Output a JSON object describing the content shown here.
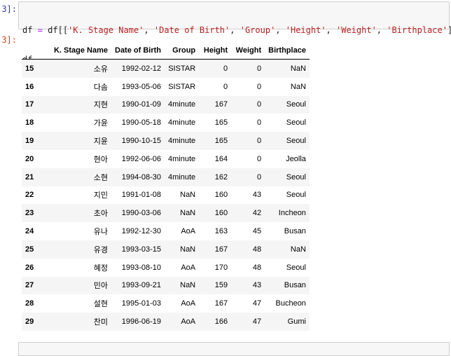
{
  "input_prompt": "3]:",
  "output_prompt": "3]:",
  "code": {
    "line1": [
      {
        "t": "name",
        "v": "df "
      },
      {
        "t": "op",
        "v": "="
      },
      {
        "t": "name",
        "v": " df"
      },
      {
        "t": "punc",
        "v": "[["
      },
      {
        "t": "str",
        "v": "'K. Stage Name'"
      },
      {
        "t": "punc",
        "v": ", "
      },
      {
        "t": "str",
        "v": "'Date of Birth'"
      },
      {
        "t": "punc",
        "v": ", "
      },
      {
        "t": "str",
        "v": "'Group'"
      },
      {
        "t": "punc",
        "v": ", "
      },
      {
        "t": "str",
        "v": "'Height'"
      },
      {
        "t": "punc",
        "v": ", "
      },
      {
        "t": "str",
        "v": "'Weight'"
      },
      {
        "t": "punc",
        "v": ", "
      },
      {
        "t": "str",
        "v": "'Birthplace'"
      },
      {
        "t": "punc",
        "v": "]]"
      }
    ],
    "line2": "df"
  },
  "table": {
    "columns": [
      "",
      "K. Stage Name",
      "Date of Birth",
      "Group",
      "Height",
      "Weight",
      "Birthplace"
    ],
    "rows": [
      [
        "15",
        "소유",
        "1992-02-12",
        "SISTAR",
        "0",
        "0",
        "NaN"
      ],
      [
        "16",
        "다솜",
        "1993-05-06",
        "SISTAR",
        "0",
        "0",
        "NaN"
      ],
      [
        "17",
        "지현",
        "1990-01-09",
        "4minute",
        "167",
        "0",
        "Seoul"
      ],
      [
        "18",
        "가윤",
        "1990-05-18",
        "4minute",
        "165",
        "0",
        "Seoul"
      ],
      [
        "19",
        "지윤",
        "1990-10-15",
        "4minute",
        "165",
        "0",
        "Seoul"
      ],
      [
        "20",
        "현아",
        "1992-06-06",
        "4minute",
        "164",
        "0",
        "Jeolla"
      ],
      [
        "21",
        "소현",
        "1994-08-30",
        "4minute",
        "162",
        "0",
        "Seoul"
      ],
      [
        "22",
        "지민",
        "1991-01-08",
        "NaN",
        "160",
        "43",
        "Seoul"
      ],
      [
        "23",
        "초아",
        "1990-03-06",
        "NaN",
        "160",
        "42",
        "Incheon"
      ],
      [
        "24",
        "유나",
        "1992-12-30",
        "AoA",
        "163",
        "45",
        "Busan"
      ],
      [
        "25",
        "유경",
        "1993-03-15",
        "NaN",
        "167",
        "48",
        "NaN"
      ],
      [
        "26",
        "혜정",
        "1993-08-10",
        "AoA",
        "170",
        "48",
        "Seoul"
      ],
      [
        "27",
        "민아",
        "1993-09-21",
        "NaN",
        "159",
        "43",
        "Busan"
      ],
      [
        "28",
        "설현",
        "1995-01-03",
        "AoA",
        "167",
        "47",
        "Bucheon"
      ],
      [
        "29",
        "찬미",
        "1996-06-19",
        "AoA",
        "166",
        "47",
        "Gumi"
      ]
    ]
  }
}
